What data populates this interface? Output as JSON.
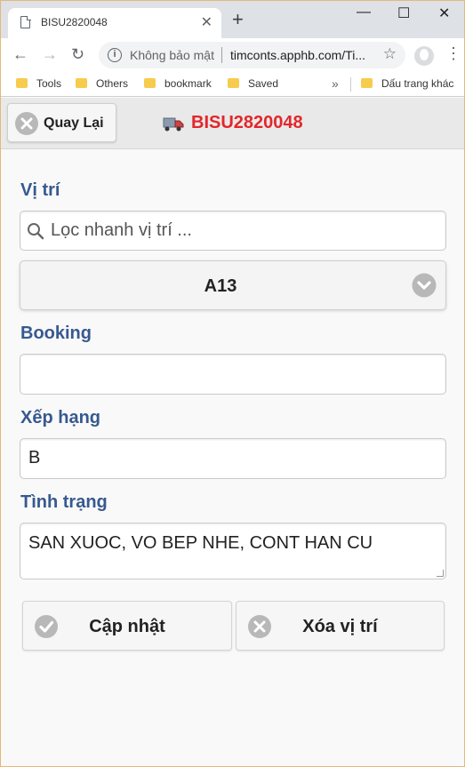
{
  "browser": {
    "tab_title": "BISU2820048",
    "tab_close": "✕",
    "new_tab": "+",
    "window_controls": {
      "minimize": "—",
      "maximize": "☐",
      "close": "✕"
    },
    "nav": {
      "back": "←",
      "forward": "→",
      "reload": "↻"
    },
    "security_label": "Không bảo mật",
    "url": "timconts.apphb.com/Ti...",
    "bookmarks": [
      "Tools",
      "Others",
      "bookmark",
      "Saved"
    ],
    "bookmarks_more": "»",
    "other_bookmarks": "Dấu trang khác"
  },
  "header": {
    "back_label": "Quay Lại",
    "container_id": "BISU2820048",
    "container_id_color": "#e3262b"
  },
  "form": {
    "location_label": "Vị trí",
    "location_search_placeholder": "Lọc nhanh vị trí ...",
    "location_selected": "A13",
    "booking_label": "Booking",
    "booking_value": "",
    "grade_label": "Xếp hạng",
    "grade_value": "B",
    "status_label": "Tình trạng",
    "status_value": "SAN XUOC, VO BEP NHE, CONT HAN CU"
  },
  "actions": {
    "update_label": "Cập nhật",
    "delete_location_label": "Xóa vị trí"
  },
  "colors": {
    "label": "#37598f",
    "accent_red": "#e3262b"
  }
}
